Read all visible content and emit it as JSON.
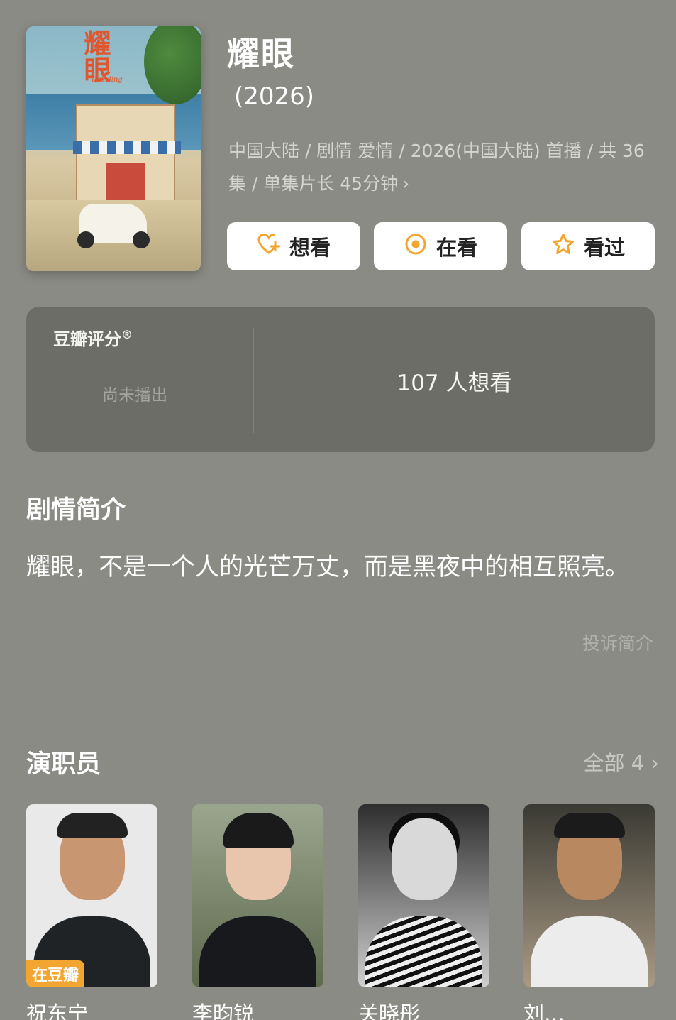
{
  "poster": {
    "calligraphy": "耀眼",
    "english_title": "Dazzling"
  },
  "header": {
    "title": "耀眼",
    "year": "(2026)",
    "meta": "中国大陆 / 剧情 爱情 / 2026(中国大陆) 首播 / 共 36集 / 单集片长 45分钟",
    "meta_chevron": "›"
  },
  "actions": {
    "want_label": "想看",
    "watching_label": "在看",
    "watched_label": "看过",
    "icon_color": "#f2a531"
  },
  "rating": {
    "label": "豆瓣评分",
    "registered_mark": "®",
    "status": "尚未播出",
    "wants_count": "107 人想看"
  },
  "synopsis": {
    "title": "剧情简介",
    "text": "耀眼，不是一个人的光芒万丈，而是黑夜中的相互照亮。",
    "report_link": "投诉简介"
  },
  "cast": {
    "title": "演职员",
    "all_link": "全部 4",
    "all_chevron": "›",
    "badge_label": "在豆瓣",
    "members": [
      {
        "name": "祝东宁"
      },
      {
        "name": "李昀锐"
      },
      {
        "name": "关晓彤"
      },
      {
        "name": "刘…"
      }
    ]
  }
}
